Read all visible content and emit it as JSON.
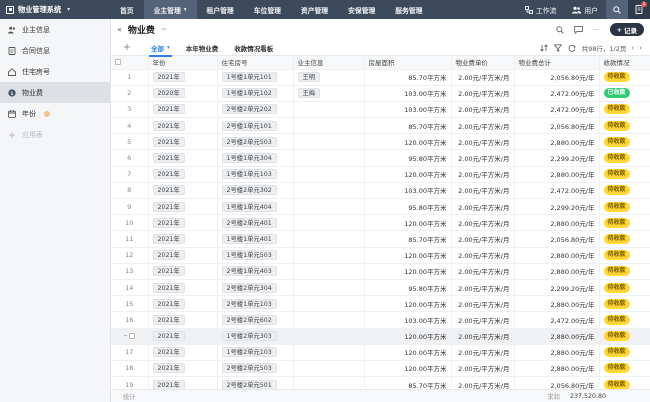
{
  "app": {
    "title": "物业管理系统",
    "notify_count": "1"
  },
  "nav": [
    {
      "label": "首页",
      "active": false,
      "chev": false
    },
    {
      "label": "业主管理",
      "active": true,
      "chev": true
    },
    {
      "label": "租户管理",
      "active": false,
      "chev": false
    },
    {
      "label": "车位管理",
      "active": false,
      "chev": false
    },
    {
      "label": "资产管理",
      "active": false,
      "chev": false
    },
    {
      "label": "安保管理",
      "active": false,
      "chev": false
    },
    {
      "label": "服务管理",
      "active": false,
      "chev": false
    }
  ],
  "topright": {
    "workflow": "工作流",
    "users": "用户"
  },
  "sidebar": [
    {
      "label": "业主信息",
      "icon": "people-icon"
    },
    {
      "label": "合同信息",
      "icon": "document-icon"
    },
    {
      "label": "住宅房号",
      "icon": "home-icon"
    },
    {
      "label": "物业费",
      "icon": "dollar-icon",
      "active": true
    },
    {
      "label": "年份",
      "icon": "calendar-icon",
      "tag": true
    },
    {
      "label": "应用表",
      "icon": "plus-icon",
      "muted": true
    }
  ],
  "page": {
    "title": "物业费",
    "add_label": "记录"
  },
  "tabs": [
    {
      "label": "全部",
      "active": true
    },
    {
      "label": "本年物业费",
      "active": false
    },
    {
      "label": "收款情况看板",
      "active": false
    }
  ],
  "pager": {
    "text": "共98行，1/2页"
  },
  "columns": [
    "年份",
    "住宅房号",
    "业主信息",
    "房屋面积",
    "物业费单价",
    "物业费总计",
    "收款情况"
  ],
  "rows": [
    {
      "n": "1",
      "year": "2021年",
      "room": "1号楼1单元101",
      "owner": "王明",
      "area": "85.70平方米",
      "price": "2.00元/平方米/月",
      "total": "2,056.80元/年",
      "status": "待收款",
      "paid": false
    },
    {
      "n": "2",
      "year": "2020年",
      "room": "1号楼1单元102",
      "owner": "王梅",
      "area": "103.00平方米",
      "price": "2.00元/平方米/月",
      "total": "2,472.00元/年",
      "status": "已收款",
      "paid": true
    },
    {
      "n": "3",
      "year": "2021年",
      "room": "2号楼2单元202",
      "owner": "",
      "area": "103.00平方米",
      "price": "2.00元/平方米/月",
      "total": "2,472.00元/年",
      "status": "待收款",
      "paid": false
    },
    {
      "n": "4",
      "year": "2021年",
      "room": "2号楼1单元101",
      "owner": "",
      "area": "85.70平方米",
      "price": "2.00元/平方米/月",
      "total": "2,056.80元/年",
      "status": "待收款",
      "paid": false
    },
    {
      "n": "5",
      "year": "2021年",
      "room": "2号楼2单元503",
      "owner": "",
      "area": "120.00平方米",
      "price": "2.00元/平方米/月",
      "total": "2,880.00元/年",
      "status": "待收款",
      "paid": false
    },
    {
      "n": "6",
      "year": "2021年",
      "room": "1号楼1单元304",
      "owner": "",
      "area": "95.80平方米",
      "price": "2.00元/平方米/月",
      "total": "2,299.20元/年",
      "status": "待收款",
      "paid": false
    },
    {
      "n": "7",
      "year": "2021年",
      "room": "1号楼1单元103",
      "owner": "",
      "area": "120.00平方米",
      "price": "2.00元/平方米/月",
      "total": "2,880.00元/年",
      "status": "待收款",
      "paid": false
    },
    {
      "n": "8",
      "year": "2021年",
      "room": "2号楼2单元302",
      "owner": "",
      "area": "103.00平方米",
      "price": "2.00元/平方米/月",
      "total": "2,472.00元/年",
      "status": "待收款",
      "paid": false
    },
    {
      "n": "9",
      "year": "2021年",
      "room": "1号楼1单元404",
      "owner": "",
      "area": "95.80平方米",
      "price": "2.00元/平方米/月",
      "total": "2,299.20元/年",
      "status": "待收款",
      "paid": false
    },
    {
      "n": "10",
      "year": "2021年",
      "room": "2号楼2单元401",
      "owner": "",
      "area": "120.00平方米",
      "price": "2.00元/平方米/月",
      "total": "2,880.00元/年",
      "status": "待收款",
      "paid": false
    },
    {
      "n": "11",
      "year": "2021年",
      "room": "1号楼1单元401",
      "owner": "",
      "area": "85.70平方米",
      "price": "2.00元/平方米/月",
      "total": "2,056.80元/年",
      "status": "待收款",
      "paid": false
    },
    {
      "n": "12",
      "year": "2021年",
      "room": "1号楼1单元503",
      "owner": "",
      "area": "120.00平方米",
      "price": "2.00元/平方米/月",
      "total": "2,880.00元/年",
      "status": "待收款",
      "paid": false
    },
    {
      "n": "13",
      "year": "2021年",
      "room": "2号楼1单元403",
      "owner": "",
      "area": "120.00平方米",
      "price": "2.00元/平方米/月",
      "total": "2,880.00元/年",
      "status": "待收款",
      "paid": false
    },
    {
      "n": "14",
      "year": "2021年",
      "room": "2号楼2单元304",
      "owner": "",
      "area": "95.80平方米",
      "price": "2.00元/平方米/月",
      "total": "2,299.20元/年",
      "status": "待收款",
      "paid": false
    },
    {
      "n": "15",
      "year": "2021年",
      "room": "2号楼1单元103",
      "owner": "",
      "area": "120.00平方米",
      "price": "2.00元/平方米/月",
      "total": "2,880.00元/年",
      "status": "待收款",
      "paid": false
    },
    {
      "n": "16",
      "year": "2021年",
      "room": "2号楼2单元602",
      "owner": "",
      "area": "103.00平方米",
      "price": "2.00元/平方米/月",
      "total": "2,472.00元/年",
      "status": "待收款",
      "paid": false
    },
    {
      "n": "17",
      "year": "2021年",
      "room": "1号楼2单元303",
      "owner": "",
      "area": "120.00平方米",
      "price": "2.00元/平方米/月",
      "total": "2,880.00元/年",
      "status": "待收款",
      "paid": false,
      "hover": true
    },
    {
      "n": "17",
      "year": "2021年",
      "room": "1号楼2单元103",
      "owner": "",
      "area": "120.00平方米",
      "price": "2.00元/平方米/月",
      "total": "2,880.00元/年",
      "status": "待收款",
      "paid": false
    },
    {
      "n": "18",
      "year": "2021年",
      "room": "2号楼2单元503",
      "owner": "",
      "area": "120.00平方米",
      "price": "2.00元/平方米/月",
      "total": "2,880.00元/年",
      "status": "待收款",
      "paid": false
    },
    {
      "n": "19",
      "year": "2021年",
      "room": "2号楼2单元501",
      "owner": "",
      "area": "85.70平方米",
      "price": "2.00元/平方米/月",
      "total": "2,056.80元/年",
      "status": "待收款",
      "paid": false
    }
  ],
  "footer": {
    "count_label": "统计",
    "sum_label": "求和",
    "sum_value": "237,520.80"
  },
  "colors": {
    "topbar": "#3d4a5c",
    "accent": "#2f80ed",
    "unpaid": "#ffd633",
    "paid": "#2ecc71",
    "add_button": "#2b3443"
  }
}
